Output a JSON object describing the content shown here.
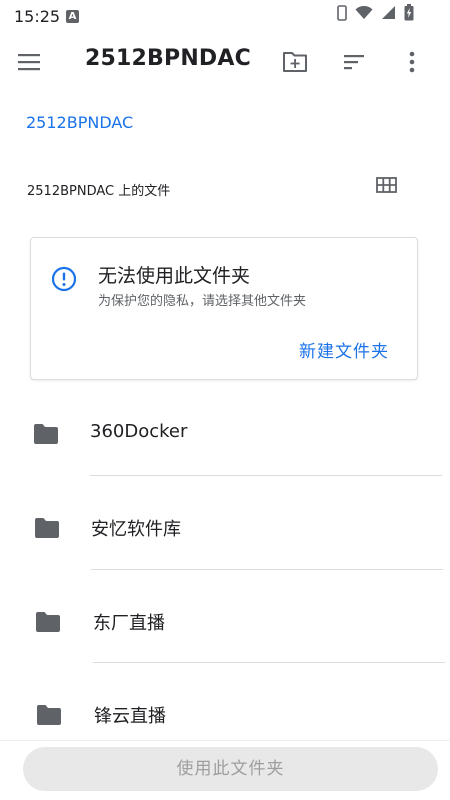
{
  "status_bar": {
    "time": "15:25",
    "notification_letter": "A",
    "icons": [
      "phone-icon",
      "wifi-icon",
      "signal-icon",
      "battery-icon"
    ]
  },
  "app_bar": {
    "title": "2512BPNDAC",
    "actions": [
      "new-folder-icon",
      "sort-icon",
      "more-icon"
    ]
  },
  "breadcrumb": {
    "label": "2512BPNDAC"
  },
  "files_header": {
    "label": "2512BPNDAC 上的文件"
  },
  "warning_card": {
    "title": "无法使用此文件夹",
    "subtitle": "为保护您的隐私，请选择其他文件夹",
    "action_label": "新建文件夹"
  },
  "folders": [
    {
      "name": "360Docker"
    },
    {
      "name": "安忆软件库"
    },
    {
      "name": "东厂直播"
    },
    {
      "name": "锋云直播"
    }
  ],
  "bottom": {
    "use_button_label": "使用此文件夹"
  },
  "colors": {
    "accent": "#1a73e8",
    "icon_gray": "#5f6368",
    "divider": "#dadce0",
    "disabled_bg": "#e8e8e8",
    "disabled_text": "#9e9e9e"
  }
}
